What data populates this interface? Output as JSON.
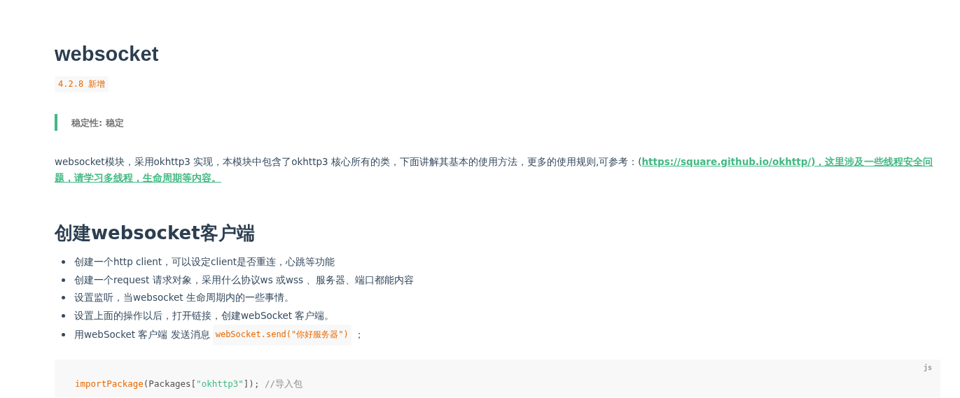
{
  "title": "websocket",
  "version_badge": "4.2.8 新增",
  "stability_note": "稳定性: 稳定",
  "intro": {
    "text": "websocket模块，采用okhttp3 实现，本模块中包含了okhttp3 核心所有的类，下面讲解其基本的使用方法，更多的使用规则,可参考：(",
    "link": "https://square.github.io/okhttp/",
    "after": ")，这里涉及一些线程安全问题，请学习多线程，生命周期等内容。"
  },
  "section_heading": "创建websocket客户端",
  "steps": [
    {
      "text": "创建一个http client，可以设定client是否重连，心跳等功能"
    },
    {
      "text": "创建一个request 请求对象，采用什么协议ws 或wss 、服务器、端口都能内容"
    },
    {
      "text": "设置监听，当websocket 生命周期内的一些事情。"
    },
    {
      "text": "设置上面的操作以后，打开链接，创建webSocket 客户端。"
    },
    {
      "text": "用webSocket 客户端 发送消息",
      "code": "webSocket.send(\"你好服务器\")",
      "after": "；"
    }
  ],
  "code_block": {
    "language": "js",
    "tokens": [
      {
        "kind": "func",
        "text": "importPackage"
      },
      {
        "kind": "plain",
        "text": "(Packages["
      },
      {
        "kind": "string",
        "text": "\"okhttp3\""
      },
      {
        "kind": "plain",
        "text": "]);"
      },
      {
        "kind": "comment",
        "text": " //导入包"
      }
    ]
  }
}
